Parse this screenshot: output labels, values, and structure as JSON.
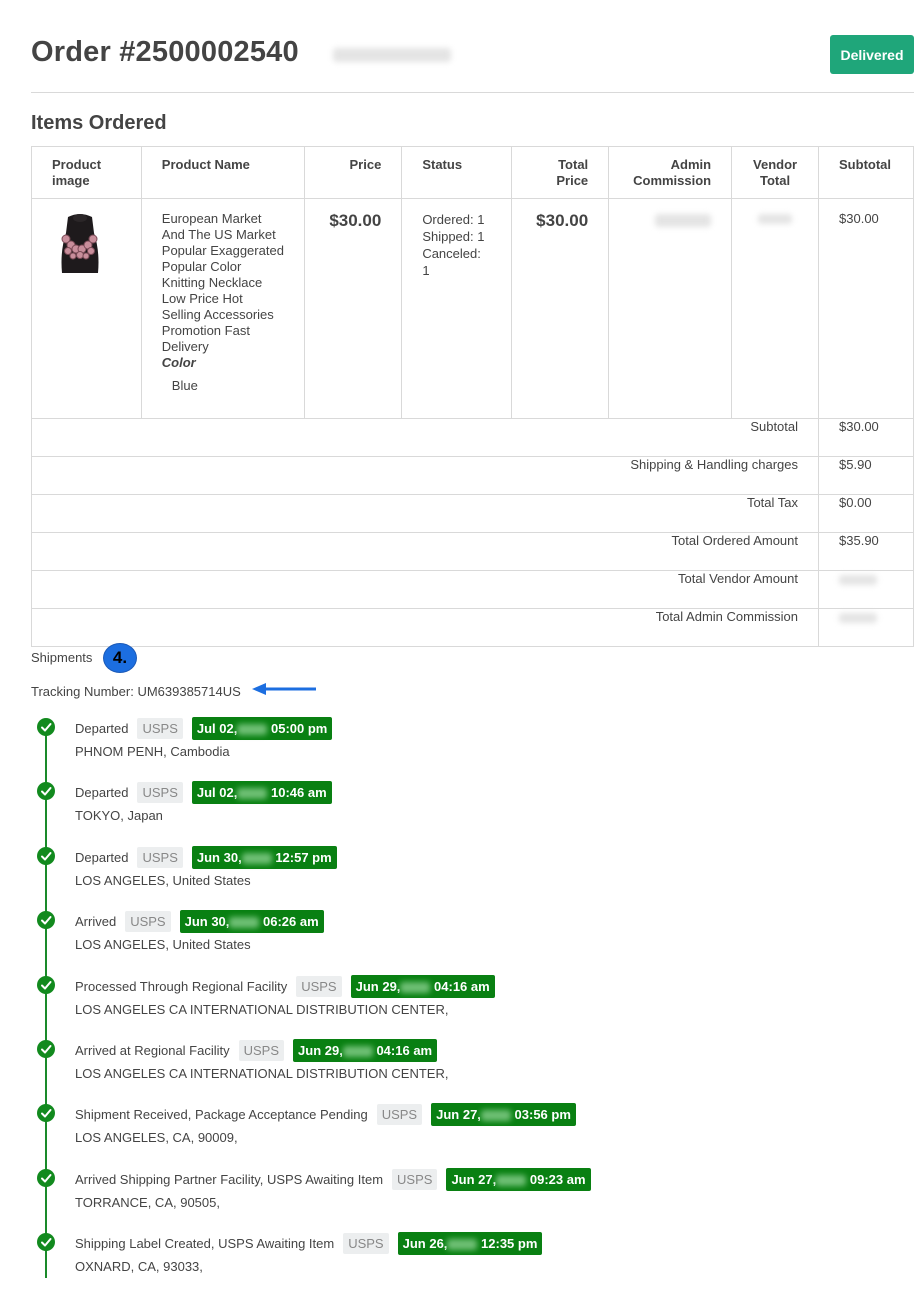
{
  "order": {
    "title": "Order #2500002540",
    "status_label": "Delivered"
  },
  "items_section": {
    "title": "Items Ordered",
    "headers": [
      "Product image",
      "Product Name",
      "Price",
      "Status",
      "Total Price",
      "Admin Commission",
      "Vendor Total",
      "Subtotal"
    ],
    "item": {
      "name": "European Market And The US Market Popular Exaggerated Popular Color Knitting Necklace Low Price Hot Selling Accessories Promotion Fast Delivery",
      "option_label": "Color",
      "option_value": "Blue",
      "price": "$30.00",
      "status_ordered": "Ordered: 1",
      "status_shipped": "Shipped: 1",
      "status_canceled": "Canceled: 1",
      "total_price": "$30.00",
      "subtotal": "$30.00"
    },
    "totals": [
      {
        "label": "Subtotal",
        "value": "$30.00"
      },
      {
        "label": "Shipping & Handling charges",
        "value": "$5.90"
      },
      {
        "label": "Total Tax",
        "value": "$0.00"
      },
      {
        "label": "Total Ordered Amount",
        "value": "$35.90"
      },
      {
        "label": "Total Vendor Amount",
        "value": ""
      },
      {
        "label": "Total Admin Commission",
        "value": ""
      }
    ]
  },
  "shipments": {
    "label": "Shipments",
    "step_badge": "4.",
    "tracking_text": "Tracking Number: UM639385714US",
    "colors": {
      "line": "#1a8a2a",
      "date_bg": "#098012",
      "badge": "#1c6ee0"
    },
    "events": [
      {
        "status": "Departed",
        "carrier": "USPS",
        "date_a": "Jul 02,",
        "date_b": "05:00 pm",
        "location": "PHNOM PENH, Cambodia"
      },
      {
        "status": "Departed",
        "carrier": "USPS",
        "date_a": "Jul 02,",
        "date_b": "10:46 am",
        "location": "TOKYO, Japan"
      },
      {
        "status": "Departed",
        "carrier": "USPS",
        "date_a": "Jun 30,",
        "date_b": "12:57 pm",
        "location": "LOS ANGELES, United States"
      },
      {
        "status": "Arrived",
        "carrier": "USPS",
        "date_a": "Jun 30,",
        "date_b": "06:26 am",
        "location": "LOS ANGELES, United States"
      },
      {
        "status": "Processed Through Regional Facility",
        "carrier": "USPS",
        "date_a": "Jun 29,",
        "date_b": "04:16 am",
        "location": "LOS ANGELES CA INTERNATIONAL DISTRIBUTION CENTER,"
      },
      {
        "status": "Arrived at Regional Facility",
        "carrier": "USPS",
        "date_a": "Jun 29,",
        "date_b": "04:16 am",
        "location": "LOS ANGELES CA INTERNATIONAL DISTRIBUTION CENTER,"
      },
      {
        "status": "Shipment Received, Package Acceptance Pending",
        "carrier": "USPS",
        "date_a": "Jun 27,",
        "date_b": "03:56 pm",
        "location": "LOS ANGELES, CA, 90009,"
      },
      {
        "status": "Arrived Shipping Partner Facility, USPS Awaiting Item",
        "carrier": "USPS",
        "date_a": "Jun 27,",
        "date_b": "09:23 am",
        "location": "TORRANCE, CA, 90505,"
      },
      {
        "status": "Shipping Label Created, USPS Awaiting Item",
        "carrier": "USPS",
        "date_a": "Jun 26,",
        "date_b": "12:35 pm",
        "location": "OXNARD, CA, 93033,"
      }
    ]
  }
}
